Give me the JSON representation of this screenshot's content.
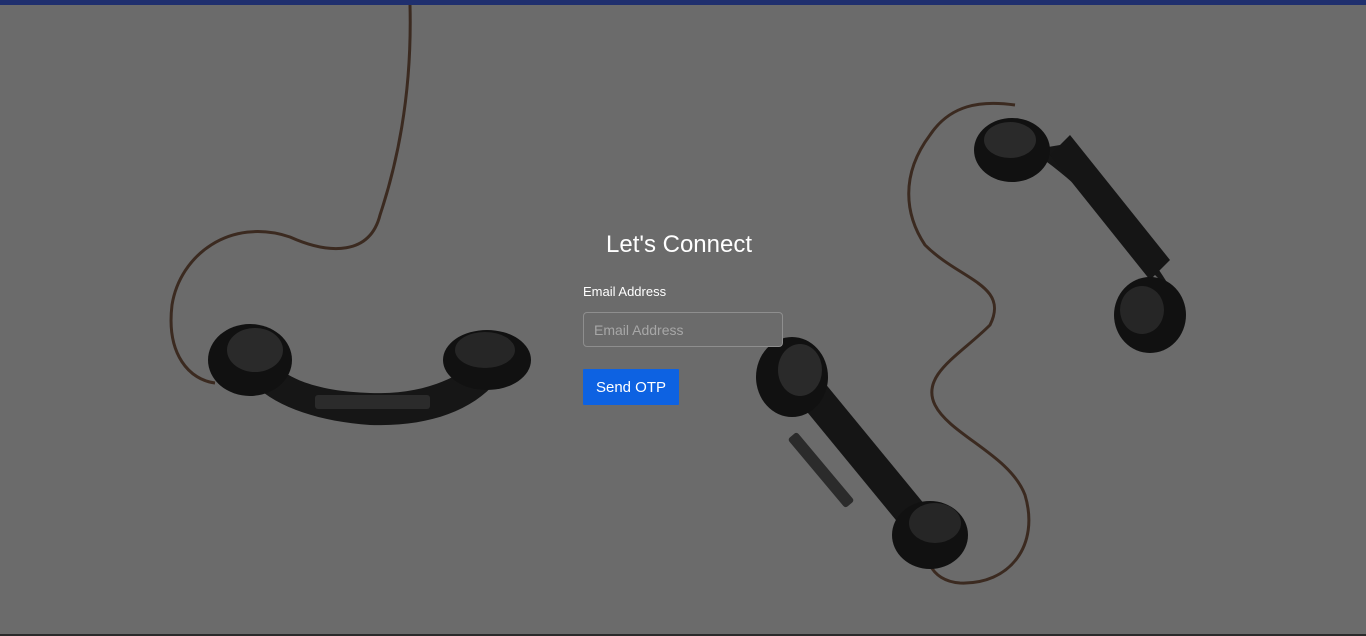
{
  "page": {
    "title": "Let's Connect"
  },
  "form": {
    "email_label": "Email Address",
    "email_placeholder": "Email Address",
    "email_value": "",
    "submit_label": "Send OTP"
  },
  "colors": {
    "background": "#6b6b6b",
    "accent": "#0d62e2",
    "top_bar": "#1f2f6e"
  },
  "background_image": {
    "subject": "three vintage telephone handsets connected by cords"
  }
}
